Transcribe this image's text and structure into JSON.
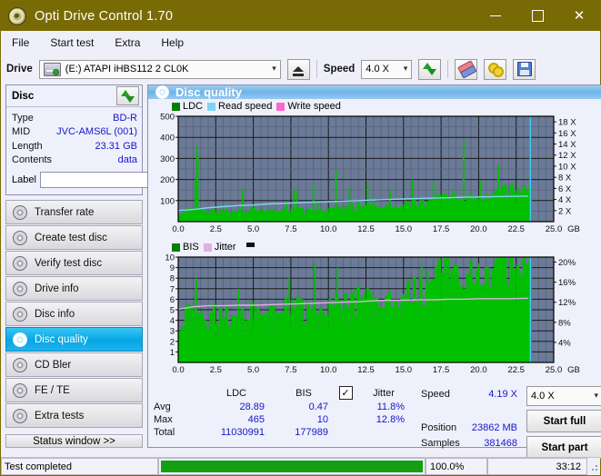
{
  "window": {
    "title": "Opti Drive Control 1.70",
    "icon": "disc-icon",
    "minimize": "—",
    "maximize": "□",
    "close": "✕"
  },
  "menu": {
    "items": [
      {
        "label": "File"
      },
      {
        "label": "Start test"
      },
      {
        "label": "Extra"
      },
      {
        "label": "Help"
      }
    ]
  },
  "toolbar": {
    "drive_label": "Drive",
    "drive_value": "(E:)  ATAPI iHBS112  2 CL0K",
    "eject_icon": "eject-icon",
    "speed_label": "Speed",
    "speed_value": "4.0 X",
    "refresh_icon": "refresh-icon",
    "erase_icon": "eraser-icon",
    "keys_icon": "keys-icon",
    "save_icon": "floppy-save-icon",
    "caret": "⌵"
  },
  "disc_panel": {
    "title": "Disc",
    "refresh_icon": "refresh-icon",
    "rows": [
      {
        "key": "Type",
        "value": "BD-R"
      },
      {
        "key": "MID",
        "value": "JVC-AMS6L (001)"
      },
      {
        "key": "Length",
        "value": "23.31 GB"
      },
      {
        "key": "Contents",
        "value": "data"
      }
    ],
    "label_key": "Label",
    "label_value": "",
    "label_button_icon": "disc-icon"
  },
  "nav": {
    "items": [
      {
        "label": "Transfer rate",
        "icon": "disc-icon",
        "active": false
      },
      {
        "label": "Create test disc",
        "icon": "disc-icon",
        "active": false
      },
      {
        "label": "Verify test disc",
        "icon": "disc-icon",
        "active": false
      },
      {
        "label": "Drive info",
        "icon": "disc-icon",
        "active": false
      },
      {
        "label": "Disc info",
        "icon": "disc-icon",
        "active": false
      },
      {
        "label": "Disc quality",
        "icon": "disc-icon",
        "active": true
      },
      {
        "label": "CD Bler",
        "icon": "disc-icon",
        "active": false
      },
      {
        "label": "FE / TE",
        "icon": "disc-icon",
        "active": false
      },
      {
        "label": "Extra tests",
        "icon": "disc-icon",
        "active": false
      }
    ],
    "status_window": "Status window >>"
  },
  "panel": {
    "header": "Disc quality",
    "header_icon": "disc-icon"
  },
  "stats": {
    "col_headers": [
      "LDC",
      "BIS"
    ],
    "jitter_label": "Jitter",
    "jitter_checked": true,
    "rows": [
      {
        "key": "Avg",
        "ldc": "28.89",
        "bis": "0.47",
        "jitter": "11.8%"
      },
      {
        "key": "Max",
        "ldc": "465",
        "bis": "10",
        "jitter": "12.8%"
      },
      {
        "key": "Total",
        "ldc": "11030991",
        "bis": "177989",
        "jitter": ""
      }
    ],
    "speed_key": "Speed",
    "speed_value": "4.19 X",
    "position_key": "Position",
    "position_value": "23862 MB",
    "samples_key": "Samples",
    "samples_value": "381468",
    "speed_select": "4.0 X",
    "start_full": "Start full",
    "start_part": "Start part"
  },
  "statusbar": {
    "message": "Test completed",
    "percent": "100.0%",
    "elapsed": "33:12",
    "progress": 100
  },
  "colors": {
    "title_bar": "#786b06",
    "accent_blue": "#06a6e4",
    "ldc_green": "#00c000",
    "bis_green": "#00c000",
    "read_speed": "#7fd4f5",
    "write_speed": "#ff66cc",
    "jitter_pink": "#e0b0e0",
    "value_blue": "#1616c8",
    "plot_bg": "#6b7a96",
    "progress_green": "#12a012"
  },
  "chart_data": [
    {
      "type": "area",
      "title": "Disc quality - LDC / Read speed",
      "xlabel": "GB",
      "ylabel": "LDC",
      "xlim": [
        0.0,
        25.0
      ],
      "ylim": [
        0,
        500
      ],
      "xticks": [
        "0.0",
        "2.5",
        "5.0",
        "7.5",
        "10.0",
        "12.5",
        "15.0",
        "17.5",
        "20.0",
        "22.5",
        "25.0"
      ],
      "yticks": [
        "100",
        "200",
        "300",
        "400",
        "500"
      ],
      "y2ticks": [
        "2 X",
        "4 X",
        "6 X",
        "8 X",
        "10 X",
        "12 X",
        "14 X",
        "16 X",
        "18 X"
      ],
      "y2lim": [
        0,
        19
      ],
      "grid": true,
      "legend": [
        {
          "name": "LDC",
          "color": "#008000"
        },
        {
          "name": "Read speed",
          "color": "#7fd4f5"
        },
        {
          "name": "Write speed",
          "color": "#ff66cc"
        }
      ],
      "series": [
        {
          "name": "LDC",
          "color": "#00c000",
          "kind": "area-spikes",
          "baseline": [
            28,
            30,
            29,
            31,
            30,
            33,
            31,
            30,
            32,
            31,
            30,
            29,
            31,
            30,
            32,
            31,
            30,
            31,
            30,
            32,
            31,
            30,
            31,
            32,
            31,
            30,
            32,
            31,
            33,
            32,
            31,
            33,
            32,
            34,
            33,
            32,
            34,
            33,
            35,
            34,
            33,
            35,
            34,
            36,
            35,
            37,
            36,
            38,
            37,
            39,
            38,
            40,
            39,
            41,
            40,
            42,
            41,
            43,
            42,
            44,
            43,
            45,
            44,
            46,
            45,
            47,
            46,
            48,
            47,
            49,
            48,
            50,
            52,
            51,
            53,
            55,
            54,
            56,
            58,
            57,
            59,
            61,
            60,
            62,
            64,
            63,
            65,
            67,
            66,
            68,
            70,
            69,
            71,
            73,
            72,
            74,
            76,
            75,
            77,
            79,
            78,
            80,
            82,
            81,
            83,
            85,
            84,
            86,
            88,
            87,
            89,
            91,
            90,
            92,
            94,
            0,
            0,
            0,
            0,
            0
          ],
          "spikes": [
            {
              "x": 1.25,
              "y": 360
            },
            {
              "x": 1.3,
              "y": 310
            },
            {
              "x": 1.15,
              "y": 200
            },
            {
              "x": 4.3,
              "y": 155
            },
            {
              "x": 5.05,
              "y": 80
            },
            {
              "x": 5.6,
              "y": 70
            },
            {
              "x": 7.2,
              "y": 95
            },
            {
              "x": 7.7,
              "y": 160
            },
            {
              "x": 7.9,
              "y": 145
            },
            {
              "x": 9.0,
              "y": 175
            },
            {
              "x": 9.3,
              "y": 95
            },
            {
              "x": 10.5,
              "y": 245
            },
            {
              "x": 11.4,
              "y": 160
            },
            {
              "x": 12.0,
              "y": 95
            },
            {
              "x": 12.6,
              "y": 190
            },
            {
              "x": 13.0,
              "y": 120
            },
            {
              "x": 14.1,
              "y": 150
            },
            {
              "x": 15.1,
              "y": 100
            },
            {
              "x": 15.6,
              "y": 200
            },
            {
              "x": 16.3,
              "y": 115
            },
            {
              "x": 17.0,
              "y": 190
            },
            {
              "x": 17.6,
              "y": 130
            },
            {
              "x": 18.3,
              "y": 155
            },
            {
              "x": 19.0,
              "y": 385
            },
            {
              "x": 19.4,
              "y": 120
            },
            {
              "x": 20.1,
              "y": 195
            },
            {
              "x": 20.8,
              "y": 130
            },
            {
              "x": 21.3,
              "y": 270
            },
            {
              "x": 21.8,
              "y": 150
            },
            {
              "x": 22.3,
              "y": 185
            },
            {
              "x": 22.7,
              "y": 160
            },
            {
              "x": 23.0,
              "y": 120
            }
          ],
          "data_end": 23.35
        },
        {
          "name": "Read speed",
          "color": "#7fd4f5",
          "kind": "line-y2",
          "points": [
            {
              "x": 0.0,
              "y": 2.0
            },
            {
              "x": 1.0,
              "y": 2.2
            },
            {
              "x": 2.0,
              "y": 2.5
            },
            {
              "x": 3.0,
              "y": 2.7
            },
            {
              "x": 4.0,
              "y": 2.9
            },
            {
              "x": 5.0,
              "y": 3.0
            },
            {
              "x": 6.0,
              "y": 3.2
            },
            {
              "x": 7.0,
              "y": 3.3
            },
            {
              "x": 8.0,
              "y": 3.4
            },
            {
              "x": 9.0,
              "y": 3.5
            },
            {
              "x": 10.0,
              "y": 3.6
            },
            {
              "x": 11.0,
              "y": 3.7
            },
            {
              "x": 12.0,
              "y": 3.8
            },
            {
              "x": 13.0,
              "y": 3.9
            },
            {
              "x": 14.0,
              "y": 4.0
            },
            {
              "x": 15.0,
              "y": 4.1
            },
            {
              "x": 16.0,
              "y": 4.2
            },
            {
              "x": 17.0,
              "y": 4.25
            },
            {
              "x": 18.0,
              "y": 4.3
            },
            {
              "x": 19.0,
              "y": 4.4
            },
            {
              "x": 20.0,
              "y": 4.45
            },
            {
              "x": 21.0,
              "y": 4.5
            },
            {
              "x": 22.0,
              "y": 4.55
            },
            {
              "x": 23.3,
              "y": 4.6
            }
          ]
        }
      ],
      "markers": [
        {
          "type": "vline",
          "x": 23.45,
          "color": "#3fc8f5"
        }
      ]
    },
    {
      "type": "area",
      "title": "Disc quality - BIS / Jitter",
      "xlabel": "GB",
      "ylabel": "BIS",
      "xlim": [
        0.0,
        25.0
      ],
      "ylim": [
        0,
        10
      ],
      "xticks": [
        "0.0",
        "2.5",
        "5.0",
        "7.5",
        "10.0",
        "12.5",
        "15.0",
        "17.5",
        "20.0",
        "22.5",
        "25.0"
      ],
      "yticks": [
        "1",
        "2",
        "3",
        "4",
        "5",
        "6",
        "7",
        "8",
        "9",
        "10"
      ],
      "y2ticks": [
        "4%",
        "8%",
        "12%",
        "16%",
        "20%"
      ],
      "y2lim": [
        0,
        21
      ],
      "grid": true,
      "legend": [
        {
          "name": "BIS",
          "color": "#008000"
        },
        {
          "name": "Jitter",
          "color": "#e0b0e0"
        }
      ],
      "series": [
        {
          "name": "BIS",
          "color": "#00c000",
          "kind": "area-spikes",
          "baseline": [
            2.4,
            2.6,
            2.5,
            2.7,
            2.6,
            2.5,
            2.7,
            2.6,
            2.4,
            2.6,
            2.5,
            2.7,
            2.6,
            2.5,
            2.7,
            2.6,
            2.7,
            2.6,
            2.8,
            2.7,
            2.6,
            2.8,
            2.7,
            2.9,
            2.8,
            2.7,
            2.9,
            2.8,
            3.0,
            2.9,
            2.8,
            3.0,
            2.9,
            3.1,
            3.0,
            2.9,
            3.1,
            3.0,
            3.2,
            3.1,
            3.0,
            3.2,
            3.1,
            3.3,
            3.2,
            3.1,
            3.3,
            3.2,
            3.4,
            3.3,
            3.2,
            3.4,
            3.3,
            3.5,
            3.4,
            3.3,
            3.5,
            3.4,
            3.6,
            3.5,
            3.4,
            3.6,
            3.5,
            3.7,
            3.6,
            3.8,
            3.7,
            3.9,
            3.8,
            4.0,
            3.9,
            4.1,
            4.0,
            4.2,
            4.1,
            4.3,
            4.2,
            4.4,
            4.3,
            4.5,
            4.4,
            4.6,
            4.5,
            4.7,
            4.6,
            4.8,
            4.7,
            4.9,
            4.8,
            5.0,
            4.9,
            5.1,
            5.0,
            5.2,
            5.1,
            5.3,
            5.2,
            5.4,
            5.3,
            5.2,
            5.4,
            5.3,
            5.5,
            5.4,
            5.3,
            5.5,
            5.4,
            5.6,
            5.5,
            5.4,
            5.6,
            5.5,
            5.4,
            5.6,
            5.5,
            0,
            0,
            0,
            0,
            0
          ],
          "spikes": [
            {
              "x": 1.2,
              "y": 8.0
            },
            {
              "x": 1.15,
              "y": 6.5
            },
            {
              "x": 4.0,
              "y": 7.0
            },
            {
              "x": 5.1,
              "y": 5.5
            },
            {
              "x": 7.4,
              "y": 8.0
            },
            {
              "x": 7.9,
              "y": 6.3
            },
            {
              "x": 9.1,
              "y": 9.3
            },
            {
              "x": 10.6,
              "y": 9.0
            },
            {
              "x": 11.7,
              "y": 7.0
            },
            {
              "x": 12.4,
              "y": 6.6
            },
            {
              "x": 13.2,
              "y": 6.2
            },
            {
              "x": 15.0,
              "y": 6.5
            },
            {
              "x": 16.2,
              "y": 9.4
            },
            {
              "x": 16.6,
              "y": 8.8
            },
            {
              "x": 17.4,
              "y": 9.0
            },
            {
              "x": 18.0,
              "y": 10.0
            },
            {
              "x": 18.6,
              "y": 9.2
            },
            {
              "x": 19.3,
              "y": 8.0
            },
            {
              "x": 20.0,
              "y": 9.4
            },
            {
              "x": 20.7,
              "y": 9.0
            },
            {
              "x": 21.5,
              "y": 8.5
            },
            {
              "x": 22.2,
              "y": 9.0
            },
            {
              "x": 22.8,
              "y": 7.5
            }
          ],
          "data_end": 23.35
        },
        {
          "name": "Jitter",
          "color": "#e0b0e0",
          "kind": "line-y2",
          "points": [
            {
              "x": 0.0,
              "y": 10.6
            },
            {
              "x": 1.0,
              "y": 11.1
            },
            {
              "x": 2.0,
              "y": 11.3
            },
            {
              "x": 3.0,
              "y": 11.3
            },
            {
              "x": 4.0,
              "y": 11.4
            },
            {
              "x": 5.0,
              "y": 11.4
            },
            {
              "x": 6.0,
              "y": 11.5
            },
            {
              "x": 7.0,
              "y": 11.6
            },
            {
              "x": 8.0,
              "y": 11.7
            },
            {
              "x": 9.0,
              "y": 11.8
            },
            {
              "x": 10.0,
              "y": 11.9
            },
            {
              "x": 11.0,
              "y": 12.0
            },
            {
              "x": 12.0,
              "y": 12.1
            },
            {
              "x": 13.0,
              "y": 12.3
            },
            {
              "x": 14.0,
              "y": 12.4
            },
            {
              "x": 15.0,
              "y": 12.4
            },
            {
              "x": 16.0,
              "y": 12.5
            },
            {
              "x": 17.0,
              "y": 12.5
            },
            {
              "x": 18.0,
              "y": 12.6
            },
            {
              "x": 19.0,
              "y": 12.6
            },
            {
              "x": 20.0,
              "y": 12.7
            },
            {
              "x": 21.0,
              "y": 12.7
            },
            {
              "x": 22.0,
              "y": 12.7
            },
            {
              "x": 23.3,
              "y": 12.8
            }
          ]
        }
      ],
      "markers": [
        {
          "type": "vline",
          "x": 23.45,
          "color": "#3fc8f5"
        }
      ]
    }
  ]
}
